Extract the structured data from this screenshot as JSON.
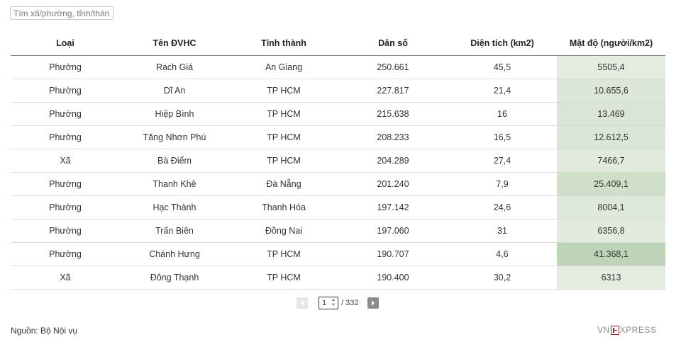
{
  "search": {
    "placeholder": "Tìm xã/phường, tỉnh/thành",
    "value": ""
  },
  "table": {
    "headers": [
      "Loại",
      "Tên ĐVHC",
      "Tỉnh thành",
      "Dân số",
      "Diện tích (km2)",
      "Mật độ (người/km2)"
    ],
    "rows": [
      [
        "Phường",
        "Rạch Giá",
        "An Giang",
        "250.661",
        "45,5",
        "5505,4"
      ],
      [
        "Phường",
        "Dĩ An",
        "TP HCM",
        "227.817",
        "21,4",
        "10.655,6"
      ],
      [
        "Phường",
        "Hiệp Bình",
        "TP HCM",
        "215.638",
        "16",
        "13.469"
      ],
      [
        "Phường",
        "Tăng Nhơn Phú",
        "TP HCM",
        "208.233",
        "16,5",
        "12.612,5"
      ],
      [
        "Xã",
        "Bà Điểm",
        "TP HCM",
        "204.289",
        "27,4",
        "7466,7"
      ],
      [
        "Phường",
        "Thanh Khê",
        "Đà Nẵng",
        "201.240",
        "7,9",
        "25.409,1"
      ],
      [
        "Phường",
        "Hạc Thành",
        "Thanh Hóa",
        "197.142",
        "24,6",
        "8004,1"
      ],
      [
        "Phường",
        "Trấn Biên",
        "Đồng Nai",
        "197.060",
        "31",
        "6356,8"
      ],
      [
        "Phường",
        "Chánh Hưng",
        "TP HCM",
        "190.707",
        "4,6",
        "41.368,1"
      ],
      [
        "Xã",
        "Đông Thạnh",
        "TP HCM",
        "190.400",
        "30,2",
        "6313"
      ]
    ],
    "density_colors": [
      "#e3ecdf",
      "#dce7d7",
      "#dae5d5",
      "#dae6d6",
      "#e1eadc",
      "#cfdfca",
      "#dfe9db",
      "#e3ebdf",
      "#bdd4b8",
      "#e4ece0"
    ]
  },
  "pagination": {
    "current_page": "1",
    "total_label": "/ 332"
  },
  "footer": {
    "source": "Nguồn: Bộ Nội vụ",
    "logo_left": "VN",
    "logo_right": "XPRESS"
  }
}
